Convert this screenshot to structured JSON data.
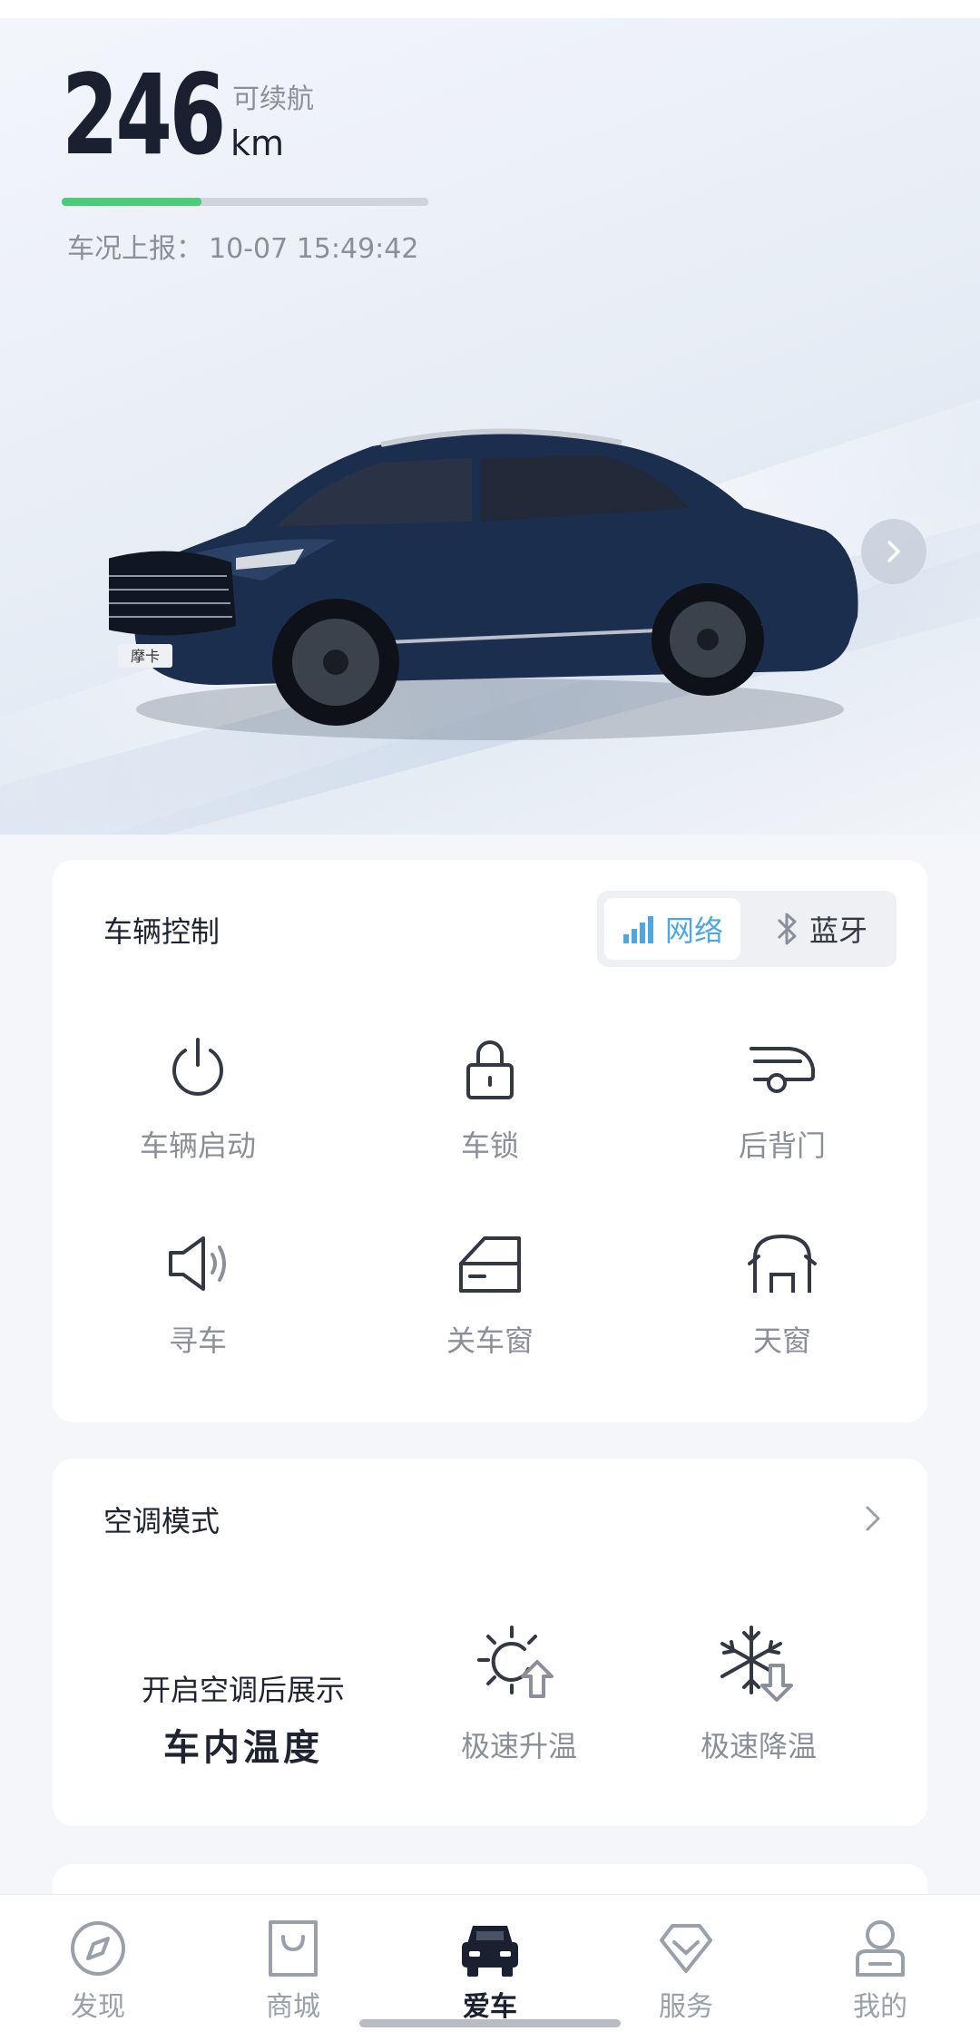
{
  "range": {
    "value": "246",
    "label": "可续航",
    "unit": "km",
    "level_fraction": 0.38
  },
  "report": {
    "label": "车况上报：",
    "timestamp": "10-07 15:49:42"
  },
  "car": {
    "badge_text": "摩卡",
    "body_color": "#1c2e4d"
  },
  "vehicle_control": {
    "title": "车辆控制",
    "mode_network": "网络",
    "mode_bluetooth": "蓝牙",
    "selected_mode": "网络",
    "items": [
      {
        "label": "车辆启动",
        "icon": "power-icon"
      },
      {
        "label": "车锁",
        "icon": "lock-icon"
      },
      {
        "label": "后背门",
        "icon": "tailgate-icon"
      },
      {
        "label": "寻车",
        "icon": "horn-icon"
      },
      {
        "label": "关车窗",
        "icon": "window-icon"
      },
      {
        "label": "天窗",
        "icon": "sunroof-icon"
      }
    ]
  },
  "ac": {
    "title": "空调模式",
    "note_line1": "开启空调后展示",
    "note_line2": "车内温度",
    "heat_label": "极速升温",
    "cool_label": "极速降温"
  },
  "tabs": [
    {
      "label": "发现",
      "icon": "compass-icon"
    },
    {
      "label": "商城",
      "icon": "shopping-bag-icon"
    },
    {
      "label": "爱车",
      "icon": "car-icon",
      "active": true
    },
    {
      "label": "服务",
      "icon": "diamond-icon"
    },
    {
      "label": "我的",
      "icon": "profile-icon"
    }
  ],
  "colors": {
    "accent": "#4ea8df",
    "range_bar": "#4ccb7a",
    "text_dark": "#1f2430",
    "text_muted": "#8a8f9a"
  }
}
